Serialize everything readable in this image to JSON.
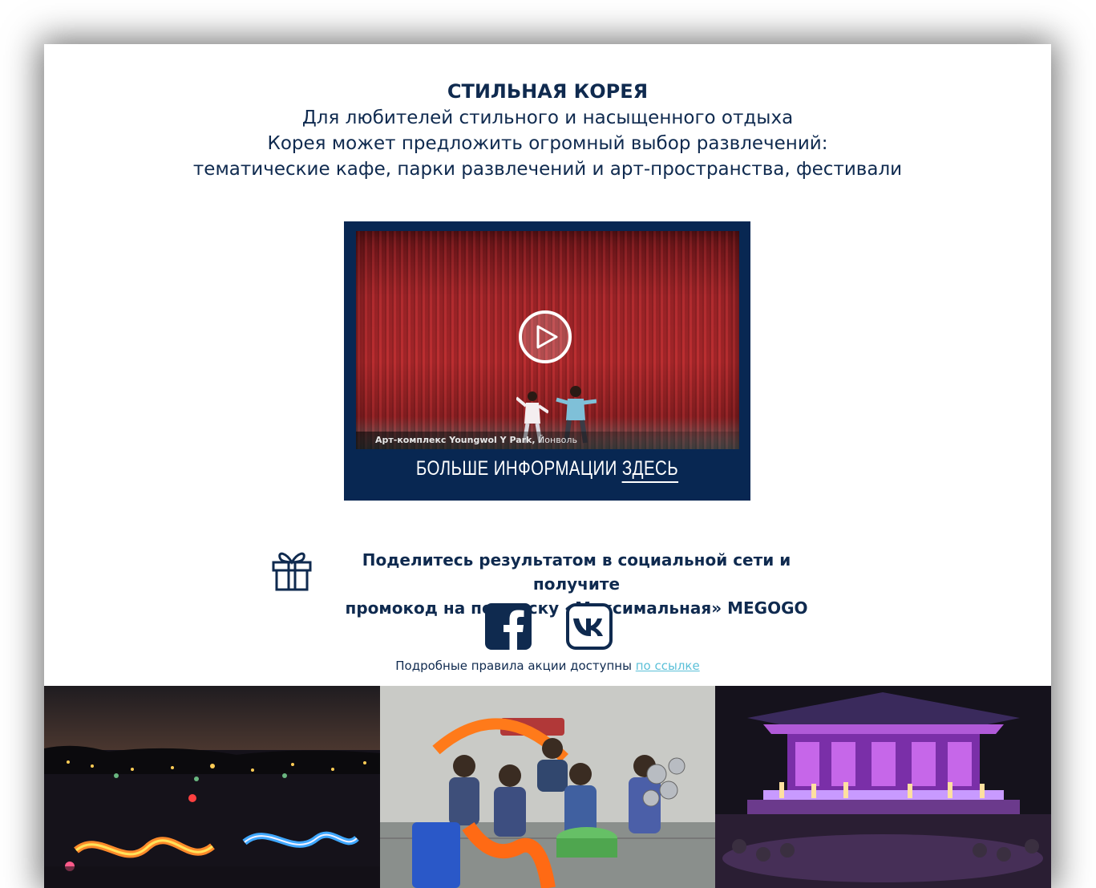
{
  "intro": {
    "title": "СТИЛЬНАЯ КОРЕЯ",
    "line1": "Для любителей стильного и насыщенного отдыха",
    "line2": "Корея может предложить огромный выбор развлечений:",
    "line3": "тематические кафе, парки развлечений и арт-пространства, фестивали"
  },
  "video": {
    "caption_bold": "Арт-комплекс Youngwol Y Park,",
    "caption_rest": " Йонволь",
    "more_info": "БОЛЬШЕ ИНФОРМАЦИИ ",
    "more_info_link": "ЗДЕСЬ",
    "play_icon": "play-icon"
  },
  "promo": {
    "line1": "Поделитесь результатом в социальной сети и получите",
    "line2": "промокод на подписку «Максимальная» MEGOGO",
    "icon": "gift-icon"
  },
  "social": {
    "facebook_icon": "facebook-icon",
    "vk_icon": "vk-icon"
  },
  "rules": {
    "text": "Подробные правила акции доступны ",
    "link": "по ссылке",
    "link_color": "#5bc0d8"
  },
  "colors": {
    "navy": "#082752",
    "text": "#0f2a4f"
  }
}
